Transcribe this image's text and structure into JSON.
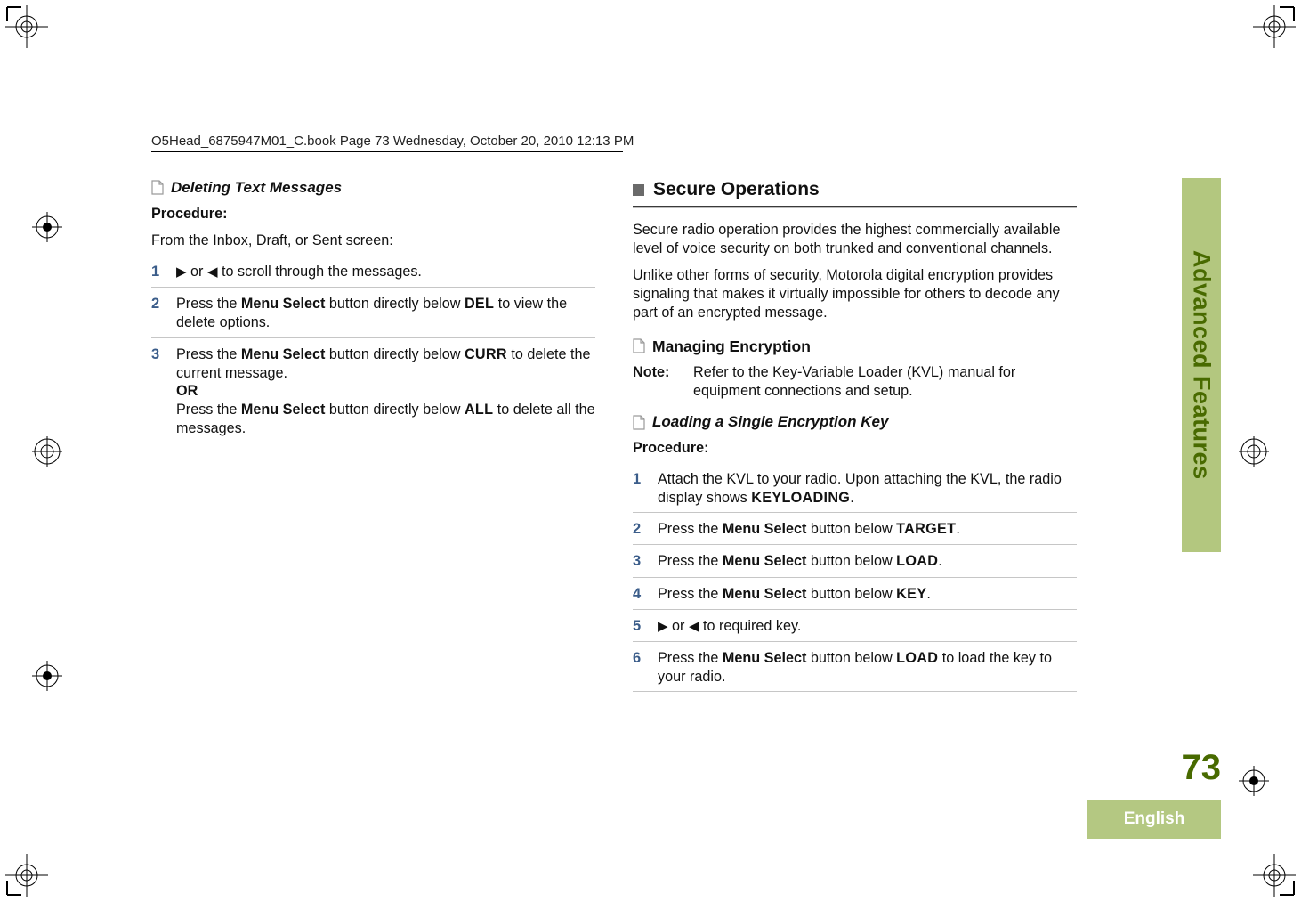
{
  "running_header": "O5Head_6875947M01_C.book  Page 73  Wednesday, October 20, 2010  12:13 PM",
  "left": {
    "heading": "Deleting Text Messages",
    "procedure_label": "Procedure:",
    "intro": "From the Inbox, Draft, or Sent screen:",
    "steps": {
      "s1_a": " or ",
      "s1_b": " to scroll through the messages.",
      "s2_a": "Press the ",
      "s2_menu": "Menu Select",
      "s2_b": " button directly below ",
      "s2_key": "DEL",
      "s2_c": " to view the delete options.",
      "s3_a": "Press the ",
      "s3_menu": "Menu Select",
      "s3_b": " button directly below ",
      "s3_key": "CURR",
      "s3_c": " to delete the current message.",
      "s3_or": "OR",
      "s3_d": "Press the ",
      "s3_menu2": "Menu Select",
      "s3_e": " button directly below ",
      "s3_key2": "ALL",
      "s3_f": " to delete all the messages."
    }
  },
  "right": {
    "section_title": "Secure Operations",
    "para1": "Secure radio operation provides the highest commercially available level of voice security on both trunked and conventional channels.",
    "para2": "Unlike other forms of security, Motorola digital encryption provides signaling that makes it virtually impossible for others to decode any part of an encrypted message.",
    "sub1": "Managing Encryption",
    "note_label": "Note:",
    "note_text": "Refer to the Key-Variable Loader (KVL) manual for equipment connections and setup.",
    "sub2": "Loading a Single Encryption Key",
    "procedure_label": "Procedure:",
    "steps": {
      "s1_a": "Attach the KVL to your radio. Upon attaching the KVL, the radio display shows ",
      "s1_key": "KEYLOADING",
      "s1_b": ".",
      "s2_a": "Press the ",
      "s2_menu": "Menu Select",
      "s2_b": " button below ",
      "s2_key": "TARGET",
      "s2_c": ".",
      "s3_a": "Press the ",
      "s3_menu": "Menu Select",
      "s3_b": " button below ",
      "s3_key": "LOAD",
      "s3_c": ".",
      "s4_a": "Press the ",
      "s4_menu": "Menu Select",
      "s4_b": " button below ",
      "s4_key": "KEY",
      "s4_c": ".",
      "s5_a": " or ",
      "s5_b": " to required key.",
      "s6_a": "Press the ",
      "s6_menu": "Menu Select",
      "s6_b": " button below ",
      "s6_key": "LOAD",
      "s6_c": " to load the key to your radio."
    }
  },
  "side_tab": "Advanced Features",
  "page_number": "73",
  "language": "English",
  "nums": {
    "n1": "1",
    "n2": "2",
    "n3": "3",
    "n4": "4",
    "n5": "5",
    "n6": "6"
  },
  "glyphs": {
    "right_arrow": "▶",
    "left_arrow": "◀"
  }
}
